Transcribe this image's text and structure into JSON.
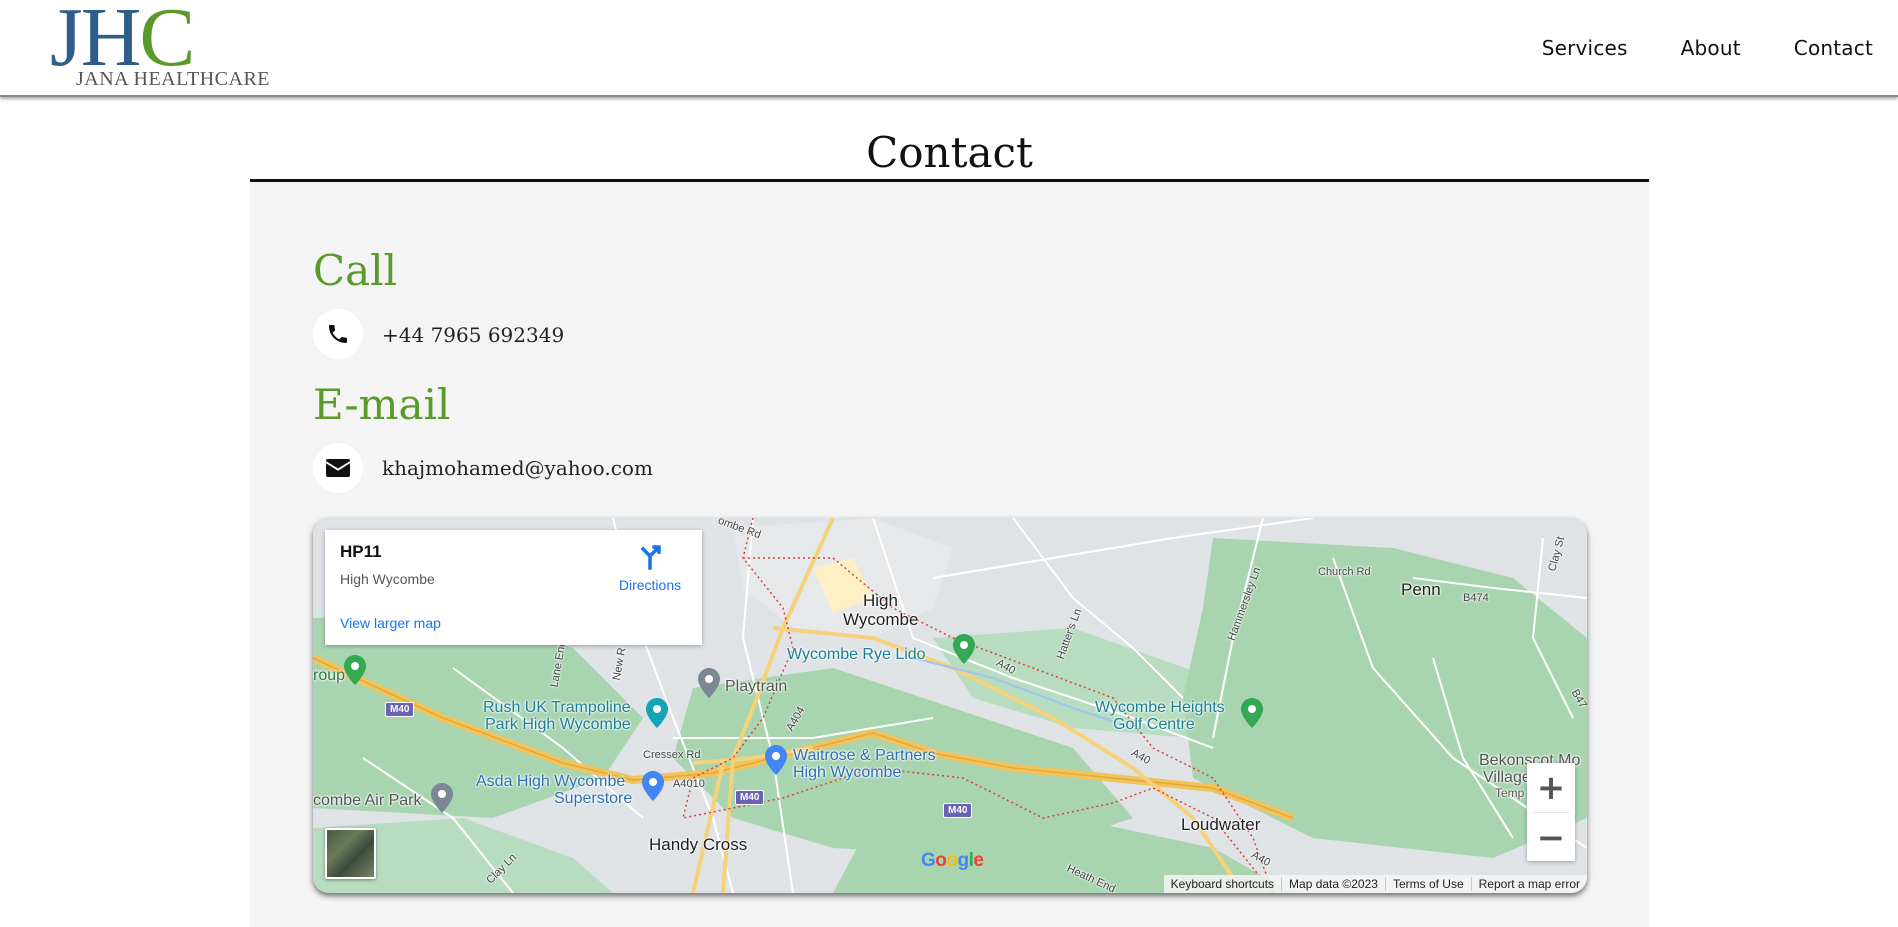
{
  "header": {
    "logo": {
      "mark": "JHC",
      "name": "JANA HEALTHCARE"
    },
    "nav": [
      "Services",
      "About",
      "Contact"
    ]
  },
  "page": {
    "title": "Contact"
  },
  "call": {
    "heading": "Call",
    "phone": "+44 7965 692349",
    "icon": "phone-icon"
  },
  "email": {
    "heading": "E-mail",
    "address": "khajmohamed@yahoo.com",
    "icon": "envelope-icon"
  },
  "map": {
    "card": {
      "place": "HP11",
      "locality": "High Wycombe",
      "directions": "Directions",
      "larger_map": "View larger map"
    },
    "labels": {
      "high_wycombe_1": "High",
      "high_wycombe_2": "Wycombe",
      "penn": "Penn",
      "loudwater": "Loudwater",
      "handy_cross": "Handy Cross",
      "rye_lido": "Wycombe Rye Lido",
      "playtrain": "Playtrain",
      "rush_1": "Rush UK Trampoline",
      "rush_2": "Park High Wycombe",
      "waitrose_1": "Waitrose & Partners",
      "waitrose_2": "High Wycombe",
      "asda_1": "Asda High Wycombe",
      "asda_2": "Superstore",
      "heights_1": "Wycombe Heights",
      "heights_2": "Golf Centre",
      "air_park": "combe Air Park",
      "group": "roup",
      "bekonscot_1": "Bekonscot Mo",
      "bekonscot_2": "Village Rail",
      "bekonscot_3": "Temp",
      "church_rd": "Church Rd",
      "b474": "B474",
      "cressex_rd": "Cressex Rd",
      "a4010": "A4010",
      "a404": "A404",
      "a40_1": "A40",
      "a40_2": "A40",
      "a40_3": "A40",
      "clay_ln": "Clay Ln",
      "heath_end": "Heath End",
      "hatters_ln": "Hatter's Ln",
      "hammersley_ln": "Hammersley Ln",
      "lane_end": "Lane End",
      "new_rd": "New R",
      "clay_st": "Clay St",
      "b47": "B47",
      "combe_rd": "ombe Rd",
      "m40_1": "M40",
      "m40_2": "M40",
      "m40_3": "M40"
    },
    "zoom_in": "+",
    "zoom_out": "−",
    "google": [
      "G",
      "o",
      "o",
      "g",
      "l",
      "e"
    ],
    "attribution": [
      "Keyboard shortcuts",
      "Map data ©2023",
      "Terms of Use",
      "Report a map error"
    ]
  },
  "colors": {
    "accent_green": "#5a9a2a",
    "logo_blue": "#2f5d8a",
    "link_blue": "#1a73e8"
  }
}
